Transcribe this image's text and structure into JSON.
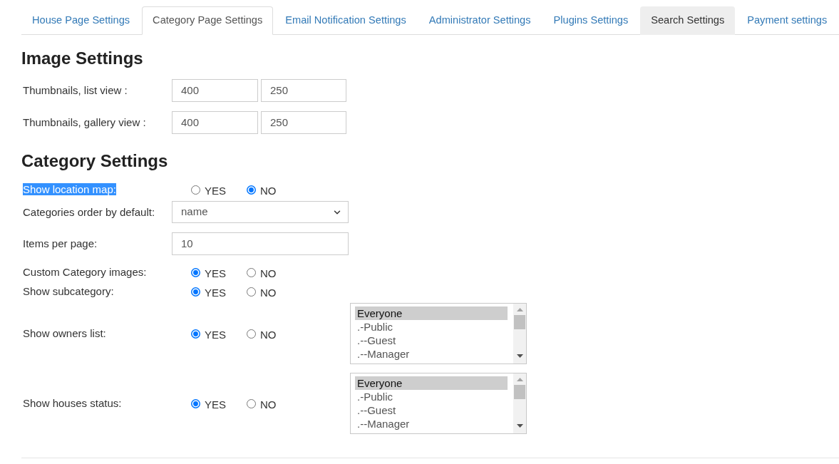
{
  "tabs": [
    {
      "label": "House Page Settings",
      "selected": false,
      "hovered": false
    },
    {
      "label": "Category Page Settings",
      "selected": true,
      "hovered": false
    },
    {
      "label": "Email Notification Settings",
      "selected": false,
      "hovered": false
    },
    {
      "label": "Administrator Settings",
      "selected": false,
      "hovered": false
    },
    {
      "label": "Plugins Settings",
      "selected": false,
      "hovered": false
    },
    {
      "label": "Search Settings",
      "selected": false,
      "hovered": true
    },
    {
      "label": "Payment settings",
      "selected": false,
      "hovered": false
    }
  ],
  "image_settings": {
    "title": "Image Settings",
    "rows": [
      {
        "label": "Thumbnails, list view :",
        "values": [
          "400",
          "250"
        ]
      },
      {
        "label": "Thumbnails, gallery view :",
        "values": [
          "400",
          "250"
        ]
      }
    ]
  },
  "category_settings": {
    "title": "Category Settings",
    "rows": [
      {
        "kind": "radio",
        "label": "Show location map:",
        "highlighted": true,
        "options": [
          {
            "label": "YES",
            "selected": false
          },
          {
            "label": "NO",
            "selected": true
          }
        ]
      },
      {
        "kind": "select",
        "label": "Categories order by default:",
        "highlighted": false,
        "value": "name"
      },
      {
        "kind": "input",
        "label": "Items per page:",
        "highlighted": false,
        "value": "10"
      },
      {
        "kind": "radio",
        "label": "Custom Category images:",
        "highlighted": false,
        "options": [
          {
            "label": "YES",
            "selected": true
          },
          {
            "label": "NO",
            "selected": false
          }
        ]
      },
      {
        "kind": "radio",
        "label": "Show subcategory:",
        "highlighted": false,
        "options": [
          {
            "label": "YES",
            "selected": true
          },
          {
            "label": "NO",
            "selected": false
          }
        ]
      },
      {
        "kind": "radio_list",
        "label": "Show owners list:",
        "highlighted": false,
        "options": [
          {
            "label": "YES",
            "selected": true
          },
          {
            "label": "NO",
            "selected": false
          }
        ],
        "list": [
          {
            "label": "Everyone",
            "selected": true
          },
          {
            "label": ".-Public",
            "selected": false
          },
          {
            "label": ".--Guest",
            "selected": false
          },
          {
            "label": ".--Manager",
            "selected": false
          }
        ]
      },
      {
        "kind": "radio_list",
        "label": "Show houses status:",
        "highlighted": false,
        "options": [
          {
            "label": "YES",
            "selected": true
          },
          {
            "label": "NO",
            "selected": false
          }
        ],
        "list": [
          {
            "label": "Everyone",
            "selected": true
          },
          {
            "label": ".-Public",
            "selected": false
          },
          {
            "label": ".--Guest",
            "selected": false
          },
          {
            "label": ".--Manager",
            "selected": false
          }
        ]
      }
    ]
  }
}
